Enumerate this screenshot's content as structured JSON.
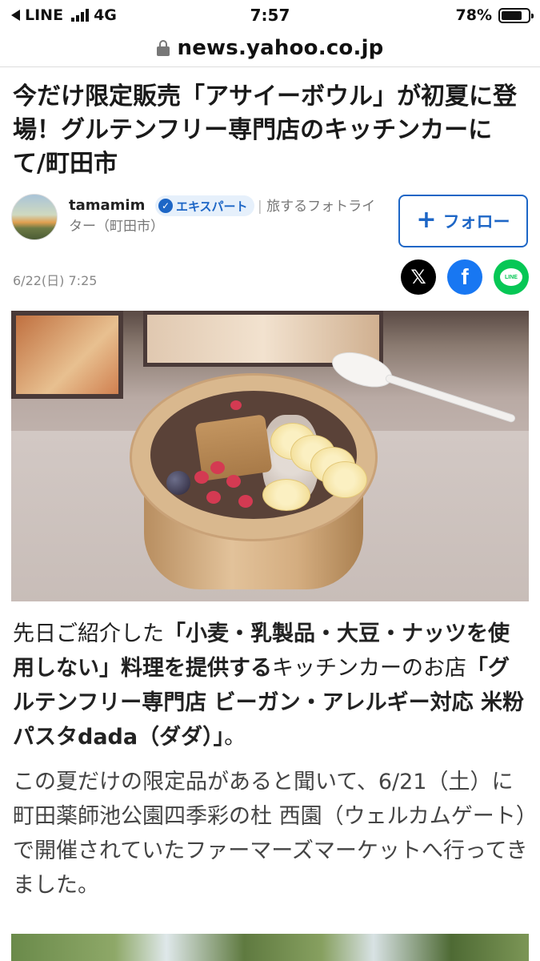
{
  "status_bar": {
    "carrier": "LINE",
    "network": "4G",
    "time": "7:57",
    "battery_percent": "78%",
    "battery_level": 0.78
  },
  "browser": {
    "url": "news.yahoo.co.jp"
  },
  "article": {
    "title": "今だけ限定販売「アサイーボウル」が初夏に登場！グルテンフリー専門店のキッチンカーにて/町田市",
    "author": {
      "name": "tamamim",
      "badge": "エキスパート",
      "separator": "|",
      "description": "旅するフォトライター（町田市）"
    },
    "follow_label": "フォロー",
    "date": "6/22(日) 7:25",
    "share": {
      "x_glyph": "𝕏",
      "facebook_glyph": "f",
      "line_label": "LINE"
    },
    "body": {
      "p1": {
        "t1": "先日ご紹介した",
        "b1": "「小麦・乳製品・大豆・ナッツを使用しない」料理を提供する",
        "t2": "キッチンカーのお店",
        "b2": "「グルテンフリー専門店 ビーガン・アレルギー対応 米粉パスタdada（ダダ）」",
        "t3": "。"
      },
      "p2": "この夏だけの限定品があると聞いて、6/21（土）に町田薬師池公園四季彩の杜 西園（ウェルカムゲート）で開催されていたファーマーズマーケットへ行ってきました。"
    }
  },
  "colors": {
    "link_blue": "#1d66c6",
    "facebook": "#1877f2",
    "line_green": "#06c755",
    "x_black": "#000000"
  },
  "icons": [
    "back-arrow-icon",
    "signal-icon",
    "battery-icon",
    "lock-icon",
    "check-icon",
    "plus-icon",
    "x-icon",
    "facebook-icon",
    "line-icon"
  ]
}
